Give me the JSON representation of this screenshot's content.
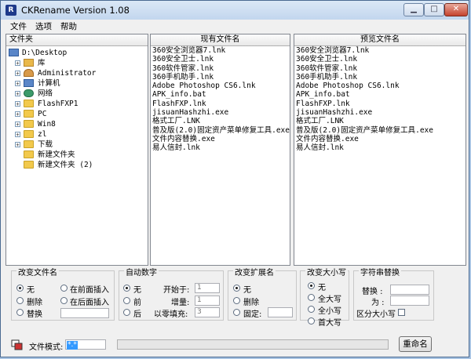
{
  "window": {
    "title": "CKRename Version 1.08",
    "app_icon_letter": "R"
  },
  "menu": [
    "文件",
    "选项",
    "帮助"
  ],
  "panes": {
    "folders": {
      "header": "文件夹",
      "items": [
        {
          "label": "D:\\Desktop",
          "icon": "desktop-icon",
          "expander": ""
        },
        {
          "label": "库",
          "icon": "library-icon",
          "expander": "+"
        },
        {
          "label": "Administrator",
          "icon": "user-folder-icon",
          "expander": "+"
        },
        {
          "label": "计算机",
          "icon": "computer-icon",
          "expander": "+"
        },
        {
          "label": "网络",
          "icon": "network-icon",
          "expander": "+"
        },
        {
          "label": "FlashFXP1",
          "icon": "folder-icon",
          "expander": "+"
        },
        {
          "label": "PC",
          "icon": "folder-icon",
          "expander": "+"
        },
        {
          "label": "Win8",
          "icon": "folder-icon",
          "expander": "+"
        },
        {
          "label": "zl",
          "icon": "folder-icon",
          "expander": "+"
        },
        {
          "label": "下载",
          "icon": "folder-icon",
          "expander": "+"
        },
        {
          "label": "新建文件夹",
          "icon": "folder-icon",
          "expander": ""
        },
        {
          "label": "新建文件夹 (2)",
          "icon": "folder-icon",
          "expander": ""
        }
      ]
    },
    "current": {
      "header": "现有文件名",
      "files": [
        "360安全浏览器7.lnk",
        "360安全卫士.lnk",
        "360软件管家.lnk",
        "360手机助手.lnk",
        "Adobe Photoshop CS6.lnk",
        "APK_info.bat",
        "FlashFXP.lnk",
        "jisuanHashzhi.exe",
        "格式工厂.LNK",
        "普及版(2.0)固定资产菜单修复工具.exe",
        "文件内容替换.exe",
        "易人信封.lnk"
      ]
    },
    "preview": {
      "header": "预览文件名",
      "files": [
        "360安全浏览器7.lnk",
        "360安全卫士.lnk",
        "360软件管家.lnk",
        "360手机助手.lnk",
        "Adobe Photoshop CS6.lnk",
        "APK_info.bat",
        "FlashFXP.lnk",
        "jisuanHashzhi.exe",
        "格式工厂.LNK",
        "普及版(2.0)固定资产菜单修复工具.exe",
        "文件内容替换.exe",
        "易人信封.lnk"
      ]
    }
  },
  "groups": {
    "rename": {
      "title": "改变文件名",
      "opt_none": "无",
      "opt_delete": "删除",
      "opt_replace": "替换",
      "opt_insert_front": "在前面插入",
      "opt_insert_back": "在后面插入"
    },
    "autonum": {
      "title": "自动数字",
      "opt_none": "无",
      "opt_front": "前",
      "opt_back": "后",
      "start_label": "开始于:",
      "start_value": "1",
      "step_label": "增量:",
      "step_value": "1",
      "pad_label": "以零填充:",
      "pad_value": "3"
    },
    "ext": {
      "title": "改变扩展名",
      "opt_none": "无",
      "opt_delete": "删除",
      "opt_fixed": "固定:"
    },
    "case": {
      "title": "改变大小写",
      "opt_none": "无",
      "opt_upper": "全大写",
      "opt_lower": "全小写",
      "opt_capital": "首大写"
    },
    "replace": {
      "title": "字符串替换",
      "replace_label": "替换 :",
      "with_label": "为 :",
      "case_label": "区分大小写"
    }
  },
  "bottom": {
    "file_mode_label": "文件模式:",
    "file_mode_value": "*.*",
    "rename_button": "重命名"
  }
}
